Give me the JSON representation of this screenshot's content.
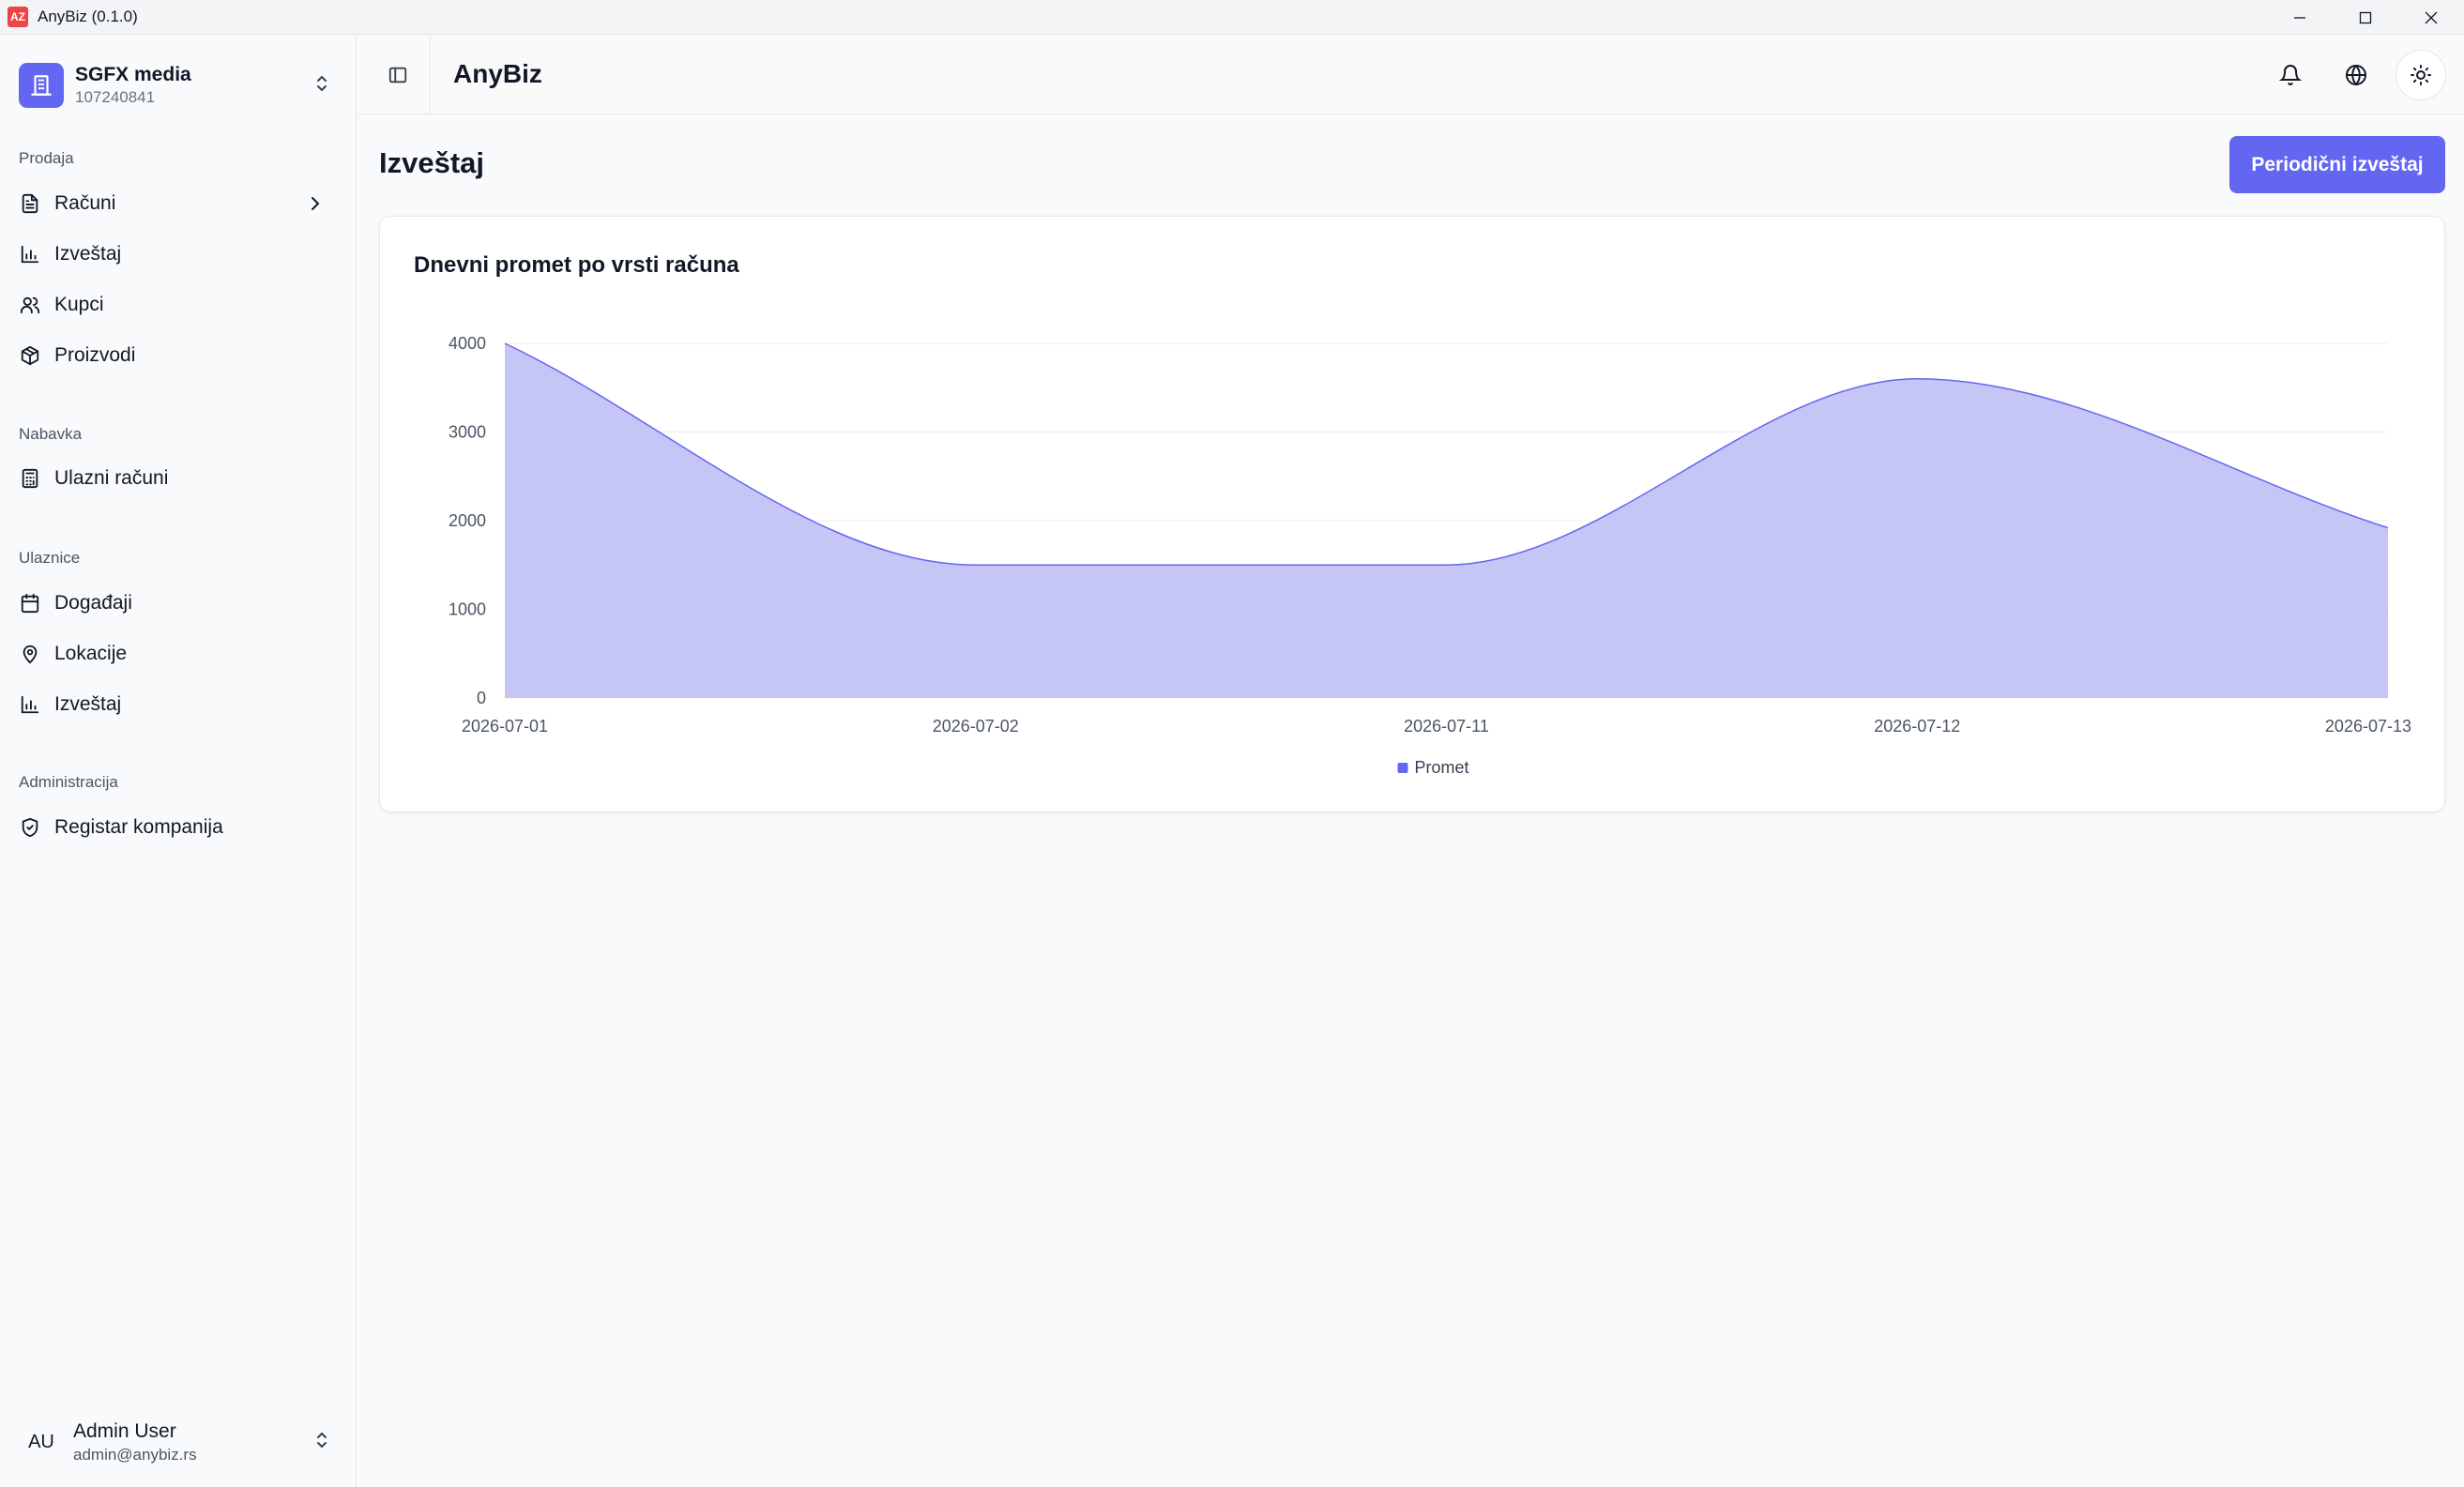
{
  "window": {
    "title": "AnyBiz (0.1.0)",
    "logo_text": "AZ"
  },
  "sidebar": {
    "company_name": "SGFX media",
    "company_id": "107240841",
    "sections": [
      {
        "label": "Prodaja",
        "items": [
          {
            "label": "Računi",
            "icon": "file-text-icon",
            "has_submenu": true
          },
          {
            "label": "Izveštaj",
            "icon": "bar-chart-icon"
          },
          {
            "label": "Kupci",
            "icon": "users-icon"
          },
          {
            "label": "Proizvodi",
            "icon": "package-icon"
          }
        ]
      },
      {
        "label": "Nabavka",
        "items": [
          {
            "label": "Ulazni računi",
            "icon": "calculator-icon"
          }
        ]
      },
      {
        "label": "Ulaznice",
        "items": [
          {
            "label": "Događaji",
            "icon": "calendar-icon"
          },
          {
            "label": "Lokacije",
            "icon": "map-pin-icon"
          },
          {
            "label": "Izveštaj",
            "icon": "bar-chart-icon"
          }
        ]
      },
      {
        "label": "Administracija",
        "items": [
          {
            "label": "Registar kompanija",
            "icon": "shield-check-icon"
          }
        ]
      }
    ],
    "user": {
      "initials": "AU",
      "name": "Admin User",
      "email": "admin@anybiz.rs"
    }
  },
  "header": {
    "app_name": "AnyBiz"
  },
  "main": {
    "page_title": "Izveštaj",
    "primary_button": "Periodični izveštaj",
    "card_title": "Dnevni promet po vrsti računa"
  },
  "colors": {
    "accent": "#6366f1",
    "area_fill": "#c2c2f5",
    "area_stroke": "#6366f1"
  },
  "chart_data": {
    "type": "area",
    "title": "Dnevni promet po vrsti računa",
    "x": [
      "2026-07-01",
      "2026-07-02",
      "2026-07-11",
      "2026-07-12",
      "2026-07-13"
    ],
    "series": [
      {
        "name": "Promet",
        "values": [
          4000,
          1500,
          1500,
          3600,
          1920
        ]
      }
    ],
    "yticks": [
      0,
      1000,
      2000,
      3000,
      4000
    ],
    "ylim": [
      0,
      4000
    ],
    "grid": true,
    "legend": "bottom-center"
  }
}
